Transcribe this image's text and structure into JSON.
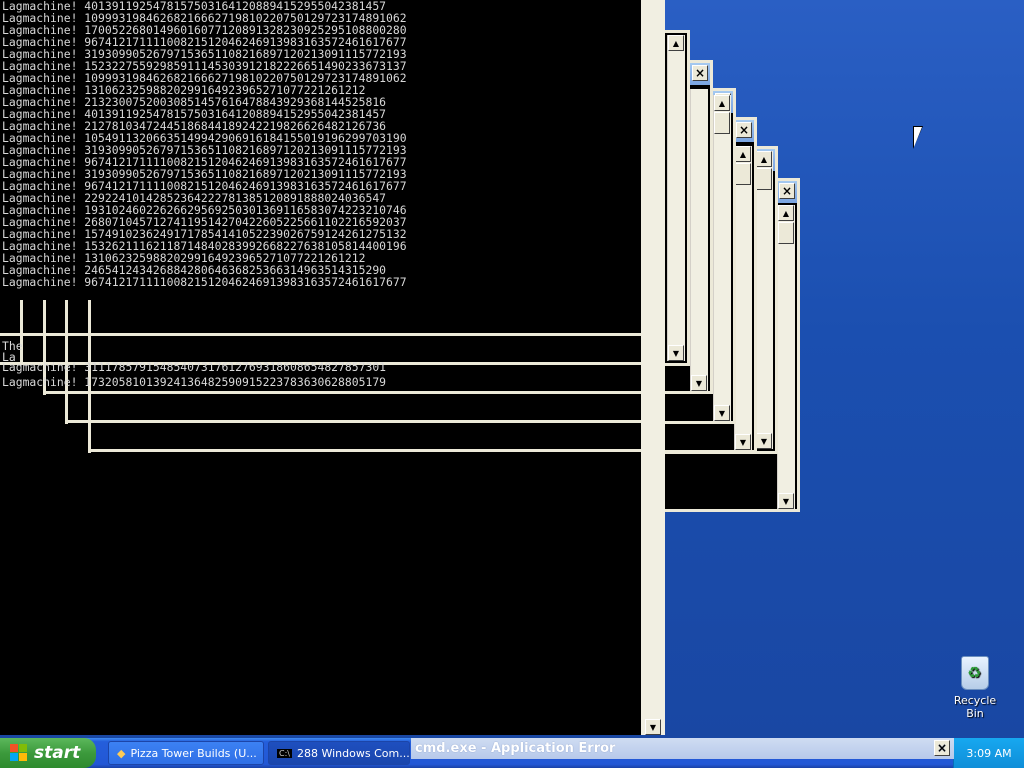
{
  "console": {
    "lines": [
      "Lagmachine! 40139119254781575031641208894152955042381457",
      "Lagmachine! 10999319846268216662719810220750129723174891062",
      "Lagmachine! 17005226801496016077120891328230925295108800280",
      "Lagmachine! 96741217111100821512046246913983163572461617677",
      "Lagmachine! 31930990526797153651108216897120213091115772193",
      "Lagmachine! 15232275592985911145303912182226651490233673137",
      "Lagmachine! 10999319846268216662719810220750129723174891062",
      "Lagmachine! 13106232598820299164923965271077221261212",
      "Lagmachine! 21323007520030851457616478843929368144525816",
      "Lagmachine! 40139119254781575031641208894152955042381457",
      "Lagmachine! 21278103472445186844189242219826626482126736",
      "Lagmachine! 10549113206635149942906916184155019196299703190",
      "Lagmachine! 31930990526797153651108216897120213091115772193",
      "Lagmachine! 96741217111100821512046246913983163572461617677",
      "Lagmachine! 31930990526797153651108216897120213091115772193",
      "Lagmachine! 96741217111100821512046246913983163572461617677",
      "Lagmachine! 22922410142852364222781385120891888024036547",
      "Lagmachine! 19310246022626629569250301369116583074223210746",
      "Lagmachine! 26807104571274119514270422605225661102216592037",
      "Lagmachine! 15749102362491717854141052239026759124261275132",
      "Lagmachine! 15326211162118714840283992668227638105814400196",
      "Lagmachine! 13106232598820299164923965271077221261212",
      "Lagmachine! 24654124342688428064636825366314963514315290",
      "Lagmachine! 96741217111100821512046246913983163572461617677"
    ],
    "stray_lines": {
      "line_a": "Lagmachine! 31117857915485407317612769318608654827857301",
      "line_b": "Lagmachine! 17320581013924136482590915223783630628805179",
      "line_c": "The",
      "line_d": "La"
    }
  },
  "window_buttons": {
    "minimize": "–",
    "maximize": "□",
    "close": "×"
  },
  "taskbar": {
    "start_label": "start",
    "tasks": [
      {
        "label": "Pizza Tower Builds (U..."
      },
      {
        "label": "288 Windows Com..."
      }
    ],
    "clock": "3:09 AM"
  },
  "error_dialog": {
    "title": "cmd.exe - Application Error",
    "close": "×"
  },
  "desktop": {
    "recycle_bin_label": "Recycle Bin"
  },
  "colors": {
    "desktop_blue": "#1b4fb0",
    "console_bg": "#000000",
    "console_text": "#d8d8d8",
    "taskbar_blue": "#245edb",
    "start_green": "#3c9a3c"
  }
}
